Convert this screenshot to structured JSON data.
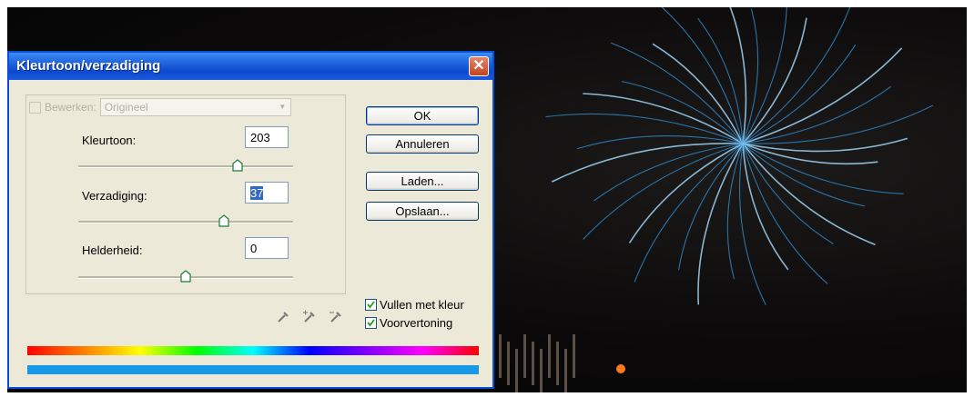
{
  "dialog": {
    "title": "Kleurtoon/verzadiging",
    "close_symbol": "✕",
    "edit_label": "Bewerken:",
    "edit_value": "Origineel",
    "hue": {
      "label": "Kleurtoon:",
      "value": "203",
      "level": 0.74
    },
    "saturation": {
      "label": "Verzadiging:",
      "value": "37",
      "level": 0.68
    },
    "lightness": {
      "label": "Helderheid:",
      "value": "0",
      "level": 0.5
    },
    "buttons": {
      "ok": "OK",
      "cancel": "Annuleren",
      "load": "Laden...",
      "save": "Opslaan..."
    },
    "checkboxes": {
      "colorize": {
        "label": "Vullen met kleur",
        "checked": true
      },
      "preview": {
        "label": "Voorvertoning",
        "checked": true
      }
    },
    "result_color": "#1a98e8"
  },
  "icons": [
    "close-icon",
    "eyedropper-icon",
    "eyedropper-plus-icon",
    "eyedropper-minus-icon",
    "checkmark-icon",
    "slider-thumb-icon"
  ]
}
